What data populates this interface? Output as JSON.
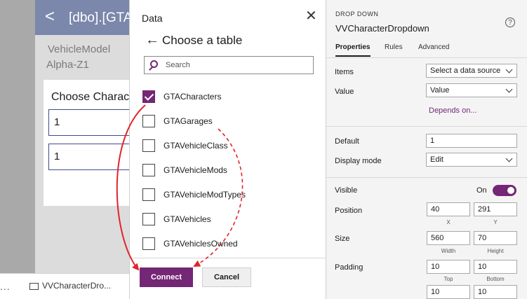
{
  "canvas": {
    "header_back": "<",
    "header_title": "[dbo].[GTA",
    "field_label": "VehicleModel",
    "field_value": "Alpha-Z1",
    "card_label": "Choose Characte",
    "box1_value": "1",
    "box2_value": "1"
  },
  "status_bar": {
    "dots": "...",
    "control_name": "VVCharacterDro..."
  },
  "data_panel": {
    "heading": "Data",
    "close_glyph": "✕",
    "back_glyph": "←",
    "subtitle": "Choose a table",
    "search_placeholder": "Search",
    "tables": [
      {
        "name": "GTACharacters",
        "checked": true
      },
      {
        "name": "GTAGarages",
        "checked": false
      },
      {
        "name": "GTAVehicleClass",
        "checked": false
      },
      {
        "name": "GTAVehicleMods",
        "checked": false
      },
      {
        "name": "GTAVehicleModTypes",
        "checked": false
      },
      {
        "name": "GTAVehicles",
        "checked": false
      },
      {
        "name": "GTAVehiclesOwned",
        "checked": false
      }
    ],
    "connect_label": "Connect",
    "cancel_label": "Cancel"
  },
  "properties": {
    "kind": "DROP DOWN",
    "control_title": "VVCharacterDropdown",
    "help_glyph": "?",
    "tabs": [
      "Properties",
      "Rules",
      "Advanced"
    ],
    "items_label": "Items",
    "items_value": "Select a data source",
    "value_label": "Value",
    "value_value": "Value",
    "depends_on": "Depends on...",
    "default_label": "Default",
    "default_value": "1",
    "display_mode_label": "Display mode",
    "display_mode_value": "Edit",
    "visible_label": "Visible",
    "visible_state": "On",
    "position_label": "Position",
    "position_x": "40",
    "position_y": "291",
    "x_label": "X",
    "y_label": "Y",
    "size_label": "Size",
    "size_width": "560",
    "size_height": "70",
    "width_label": "Width",
    "height_label": "Height",
    "padding_label": "Padding",
    "padding_top": "10",
    "padding_bottom": "10",
    "padding_left": "10",
    "padding_right": "10",
    "top_label": "Top",
    "bottom_label": "Bottom"
  },
  "colors": {
    "accent": "#742774",
    "header": "#7b87ab",
    "annotation": "#e0252b"
  }
}
